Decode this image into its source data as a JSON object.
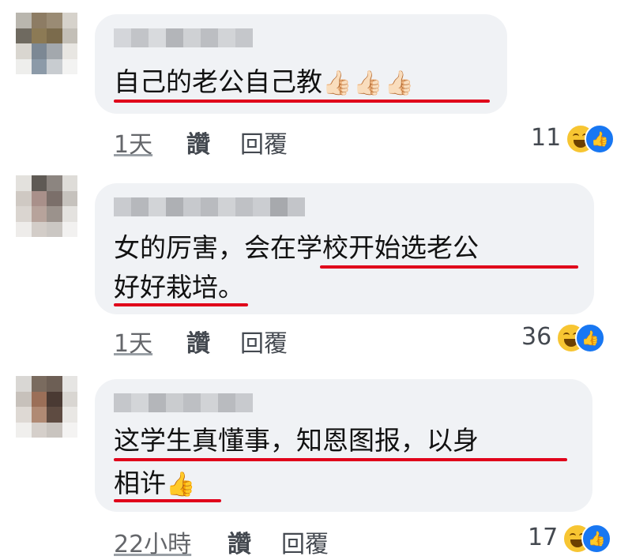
{
  "comments": [
    {
      "lines": [
        "自己的老公自己教"
      ],
      "emoji": "👍🏻👍🏻👍🏻",
      "time": "1天",
      "like": "讚",
      "reply": "回覆",
      "count": "11"
    },
    {
      "lines": [
        "女的厉害，会在学校开始选老公",
        "好好栽培",
        "。"
      ],
      "time": "1天",
      "like": "讚",
      "reply": "回覆",
      "count": "36"
    },
    {
      "lines": [
        "这学生真懂事，知恩图报，以身",
        "相许"
      ],
      "emoji": "👍",
      "time": "22小時",
      "like": "讚",
      "reply": "回覆",
      "count": "17"
    }
  ],
  "colors": {
    "bubble": "#f0f2f5",
    "underline": "#e0001a",
    "like": "#1877f2",
    "laugh": "#f7c532"
  },
  "icons": [
    "laugh-reaction-icon",
    "like-reaction-icon",
    "thumbs-up-emoji"
  ]
}
